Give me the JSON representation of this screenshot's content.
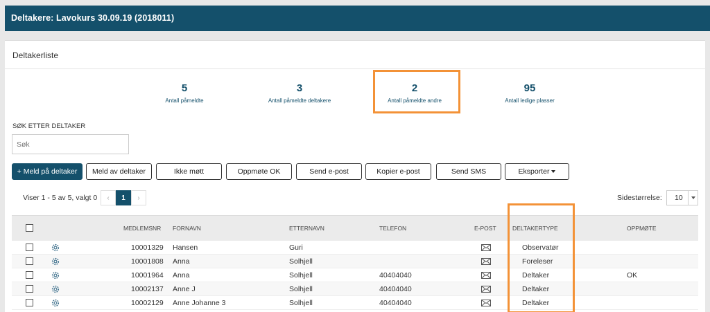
{
  "header": {
    "title": "Deltakere: Lavokurs 30.09.19 (2018011)"
  },
  "card": {
    "title": "Deltakerliste"
  },
  "stats": [
    {
      "value": "5",
      "label": "Antall påmeldte"
    },
    {
      "value": "3",
      "label": "Antall påmeldte deltakere"
    },
    {
      "value": "2",
      "label": "Antall påmeldte andre"
    },
    {
      "value": "95",
      "label": "Antall ledige plasser"
    }
  ],
  "search": {
    "label": "SØK ETTER DELTAKER",
    "placeholder": "Søk"
  },
  "toolbar": {
    "add": "+ Meld på deltaker",
    "remove": "Meld av deltaker",
    "noshow": "Ikke møtt",
    "attendance_ok": "Oppmøte OK",
    "send_email": "Send e-post",
    "copy_email": "Kopier e-post",
    "send_sms": "Send SMS",
    "export": "Eksporter"
  },
  "pager": {
    "info": "Viser 1 - 5 av 5, valgt 0",
    "prev": "‹",
    "current": "1",
    "next": "›"
  },
  "page_size": {
    "label": "Sidestørrelse:",
    "value": "10"
  },
  "table": {
    "headers": {
      "member_no": "MEDLEMSNR",
      "first_name": "FORNAVN",
      "last_name": "ETTERNAVN",
      "phone": "TELEFON",
      "email": "E-POST",
      "type": "DELTAKERTYPE",
      "attendance": "OPPMØTE"
    },
    "rows": [
      {
        "member_no": "10001329",
        "first_name": "Hansen",
        "last_name": "Guri",
        "phone": "",
        "type": "Observatør",
        "attendance": ""
      },
      {
        "member_no": "10001808",
        "first_name": "Anna",
        "last_name": "Solhjell",
        "phone": "",
        "type": "Foreleser",
        "attendance": ""
      },
      {
        "member_no": "10001964",
        "first_name": "Anna",
        "last_name": "Solhjell",
        "phone": "40404040",
        "type": "Deltaker",
        "attendance": "OK"
      },
      {
        "member_no": "10002137",
        "first_name": "Anne J",
        "last_name": "Solhjell",
        "phone": "40404040",
        "type": "Deltaker",
        "attendance": ""
      },
      {
        "member_no": "10002129",
        "first_name": "Anne Johanne 3",
        "last_name": "Solhjell",
        "phone": "40404040",
        "type": "Deltaker",
        "attendance": ""
      }
    ]
  },
  "colors": {
    "brand": "#14506b",
    "highlight": "#f39237"
  },
  "icons": {
    "row_settings": "gear-icon",
    "row_email": "envelope-icon",
    "export_caret": "caret-down-icon"
  }
}
